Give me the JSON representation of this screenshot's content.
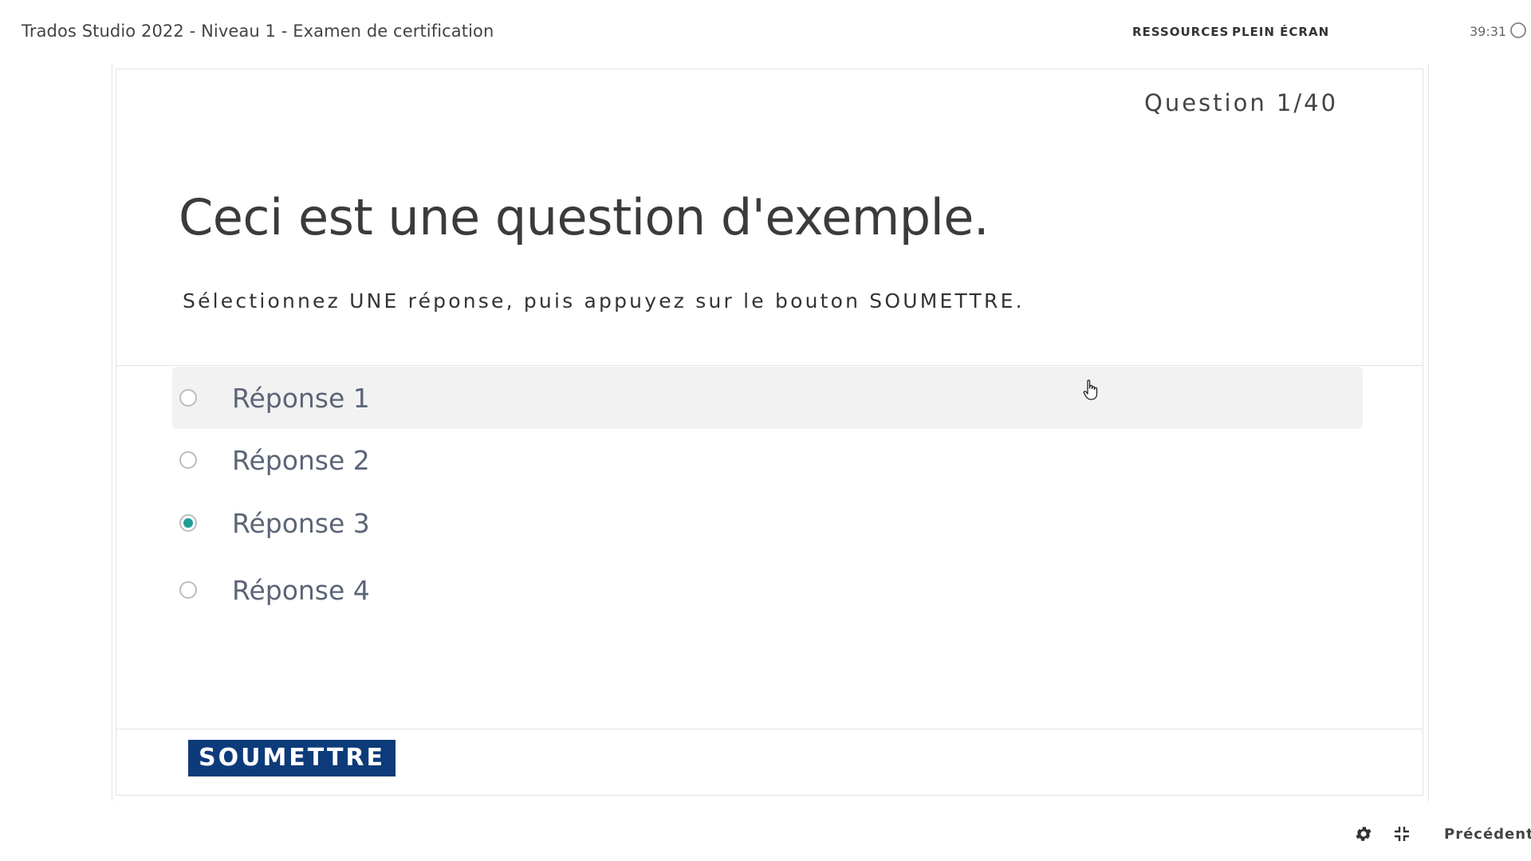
{
  "header": {
    "title": "Trados Studio 2022 - Niveau 1 - Examen de certification",
    "resources_label": "RESSOURCES",
    "fullscreen_label": "PLEIN ÉCRAN",
    "timer": "39:31"
  },
  "slide": {
    "counter": "Question 1/40",
    "title": "Ceci est une question d'exemple.",
    "instructions": "Sélectionnez UNE réponse, puis appuyez sur le bouton SOUMETTRE.",
    "answers": [
      {
        "label": "Réponse 1",
        "selected": false
      },
      {
        "label": "Réponse 2",
        "selected": false
      },
      {
        "label": "Réponse 3",
        "selected": true
      },
      {
        "label": "Réponse 4",
        "selected": false
      }
    ],
    "submit_label": "SOUMETTRE"
  },
  "footer": {
    "previous_label": "Précédent"
  },
  "colors": {
    "accent_radio": "#1f9e98",
    "submit_bg": "#0d3b7a",
    "answer_text": "#5b6577"
  },
  "icons": {
    "timer": "progress-circle-icon",
    "cursor": "hand-pointer-icon",
    "settings": "gear-icon",
    "exit_fullscreen": "shrink-icon"
  }
}
